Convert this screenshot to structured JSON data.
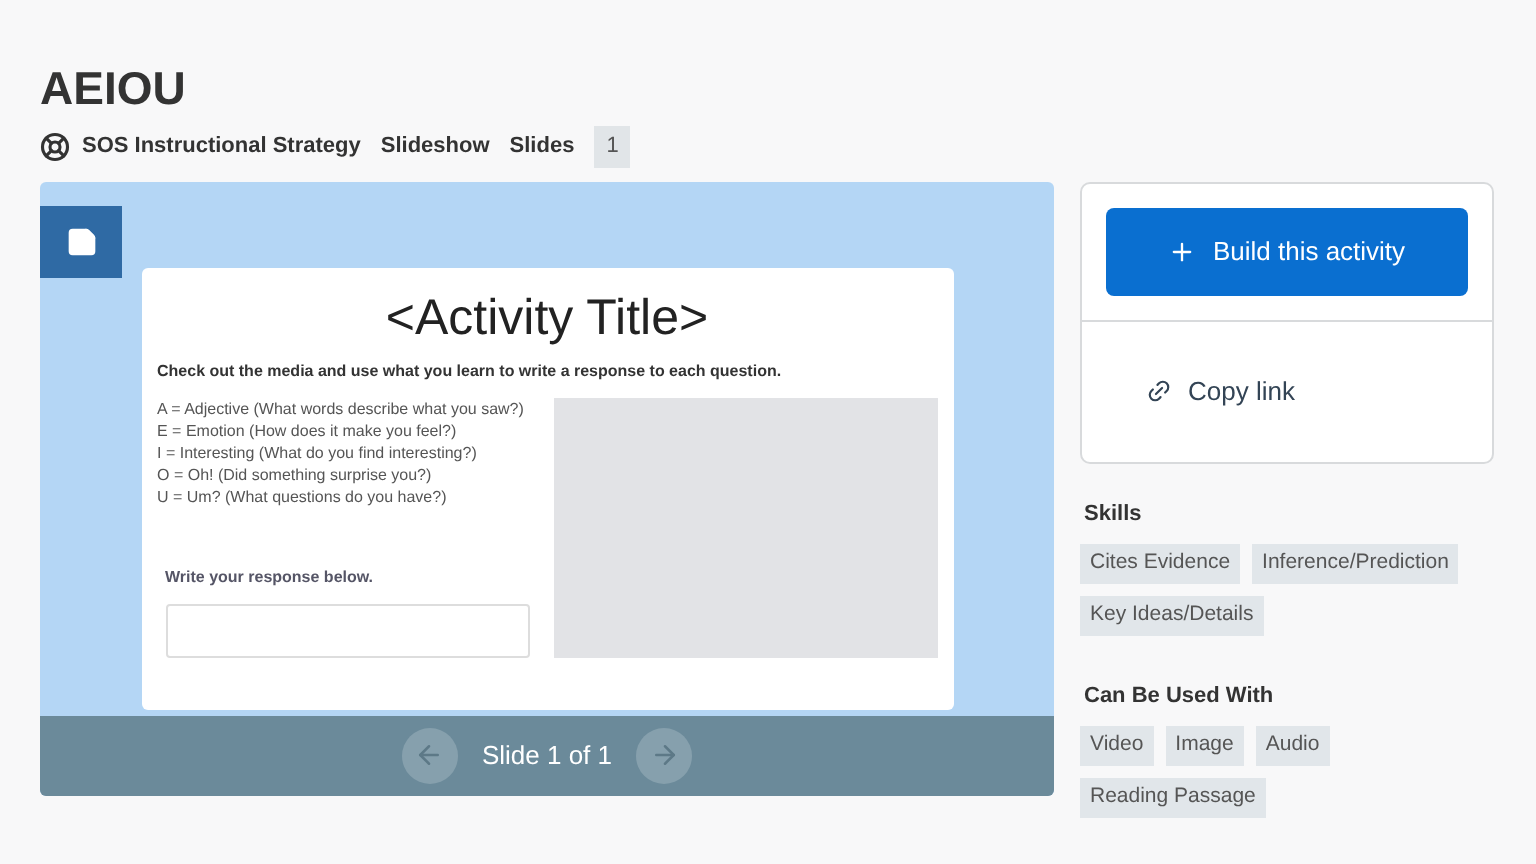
{
  "title": "AEIOU",
  "meta": {
    "strategy": "SOS Instructional Strategy",
    "type": "Slideshow",
    "slides_label": "Slides",
    "slides_count": "1"
  },
  "slide": {
    "title": "<Activity Title>",
    "instructions": "Check out the media and use what you learn to write a response to each question.",
    "lines": [
      "A = Adjective (What words describe what you saw?)",
      "E = Emotion (How does it make you feel?)",
      "I = Interesting (What do you find interesting?)",
      "O = Oh! (Did something surprise you?)",
      "U = Um? (What questions do you have?)"
    ],
    "response_label": "Write your response below."
  },
  "pager": {
    "label": "Slide 1 of 1"
  },
  "actions": {
    "build": "Build this activity",
    "copy": "Copy link"
  },
  "sections": [
    {
      "heading": "Skills",
      "tags": [
        "Cites Evidence",
        "Inference/Prediction",
        "Key Ideas/Details"
      ]
    },
    {
      "heading": "Can Be Used With",
      "tags": [
        "Video",
        "Image",
        "Audio",
        "Reading Passage"
      ]
    }
  ]
}
